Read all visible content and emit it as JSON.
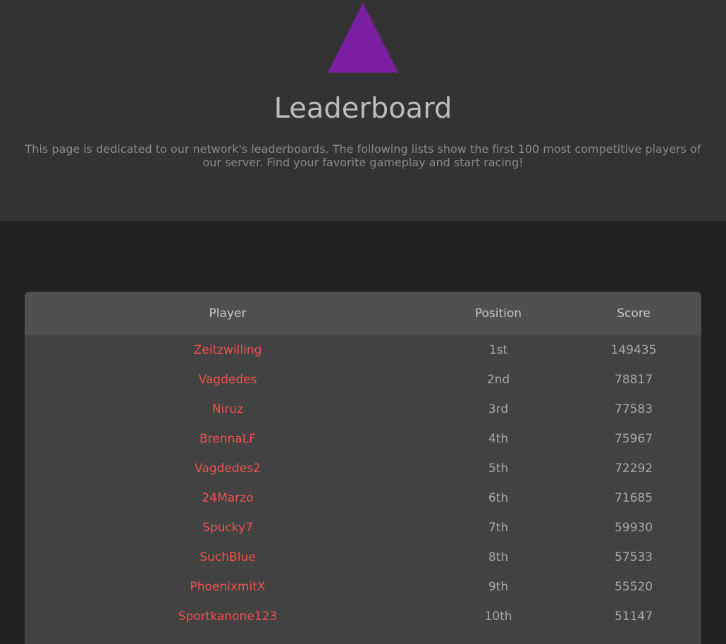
{
  "colors": {
    "hero_bg": "#333333",
    "page_bg": "#212121",
    "board_bg": "#424242",
    "board_head_bg": "#505050",
    "logo": "#7b1fa2",
    "player_link": "#ef5350"
  },
  "header": {
    "logo_icon": "triangle-logo",
    "title": "Leaderboard",
    "description": "This page is dedicated to our network's leaderboards. The following lists show the first 100 most competitive players of our server. Find your favorite gameplay and start racing!"
  },
  "leaderboard": {
    "columns": [
      "Player",
      "Position",
      "Score"
    ],
    "rows": [
      {
        "player": "Zeitzwilling",
        "position": "1st",
        "score": "149435"
      },
      {
        "player": "Vagdedes",
        "position": "2nd",
        "score": "78817"
      },
      {
        "player": "Niruz",
        "position": "3rd",
        "score": "77583"
      },
      {
        "player": "BrennaLF",
        "position": "4th",
        "score": "75967"
      },
      {
        "player": "Vagdedes2",
        "position": "5th",
        "score": "72292"
      },
      {
        "player": "24Marzo",
        "position": "6th",
        "score": "71685"
      },
      {
        "player": "Spucky7",
        "position": "7th",
        "score": "59930"
      },
      {
        "player": "SuchBlue",
        "position": "8th",
        "score": "57533"
      },
      {
        "player": "PhoenixmitX",
        "position": "9th",
        "score": "55520"
      },
      {
        "player": "Sportkanone123",
        "position": "10th",
        "score": "51147"
      }
    ]
  }
}
